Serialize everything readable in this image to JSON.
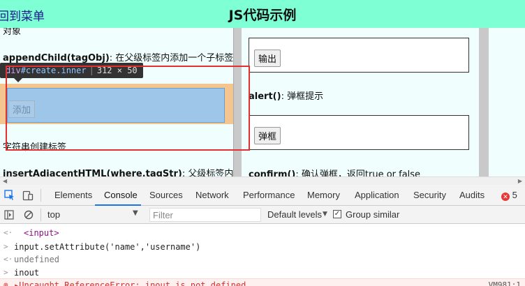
{
  "header": {
    "back_link": "回到菜单",
    "title": "JS代码示例"
  },
  "left_col": {
    "top_cut_text": "对象",
    "append_method": "appendChild(tagObj)",
    "append_desc": ": 在父级标签内添加一个子标签",
    "add_button": "添加",
    "string_heading": "字符串创建标签",
    "insert_method": "insertAdjacentHTML(where,tagStr)",
    "insert_desc": ": 父级标签内添"
  },
  "tooltip": {
    "tag": "div",
    "class": "#create.inner",
    "size": "312 × 50"
  },
  "mid_col": {
    "output_button": "输出",
    "alert_method": "alert()",
    "alert_desc": ": 弹框提示",
    "popup_button": "弹框",
    "confirm_method": "confirm()",
    "confirm_desc": ": 确认弹框，返回true or false"
  },
  "devtools": {
    "tabs": [
      "Elements",
      "Console",
      "Sources",
      "Network",
      "Performance",
      "Memory",
      "Application",
      "Security",
      "Audits"
    ],
    "active_tab": "Console",
    "error_count": "5",
    "context": "top",
    "filter_placeholder": "Filter",
    "levels": "Default levels",
    "group_similar": "Group similar"
  },
  "console": {
    "lines": [
      {
        "prefix": "<·",
        "text": "<input>"
      },
      {
        "prefix": ">",
        "text": "input.setAttribute('name','username')"
      },
      {
        "prefix": "<·",
        "text": "undefined"
      },
      {
        "prefix": ">",
        "text": "inout"
      },
      {
        "prefix": "⊗",
        "text": "▸Uncaught ReferenceError: inout is not defined",
        "source": "VM981:1"
      }
    ]
  },
  "colors": {
    "header_bg": "#7fffd4",
    "page_bg": "#f0fffd",
    "highlight_margin": "#f4c58e",
    "highlight_content": "#9ec6e8",
    "annotation_frame": "#e03030",
    "devtools_accent": "#1a73e8",
    "error": "#d32f2f"
  }
}
